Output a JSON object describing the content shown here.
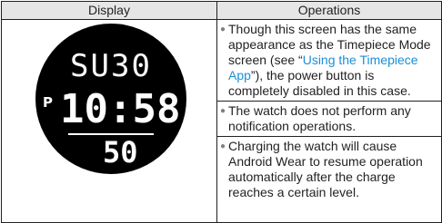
{
  "table": {
    "header_display": "Display",
    "header_operations": "Operations"
  },
  "watch": {
    "top_line": "SU30",
    "pm_indicator": "P",
    "time": "10:58",
    "seconds": "50"
  },
  "operations": {
    "bullet_1": {
      "text_before": "Though this screen has the same appearance as the Timepiece Mode screen (see “",
      "link_text": "Using the Timepiece App",
      "text_after": "”), the power button is completely disabled in this case."
    },
    "bullet_2": "The watch does not perform any notification operations.",
    "bullet_3": "Charging the watch will cause Android Wear to resume operation automatically after the charge reaches a certain level."
  },
  "colors": {
    "link": "#1a8fd6",
    "header_bg": "#e6e6e6",
    "watch_face": "#000000"
  }
}
